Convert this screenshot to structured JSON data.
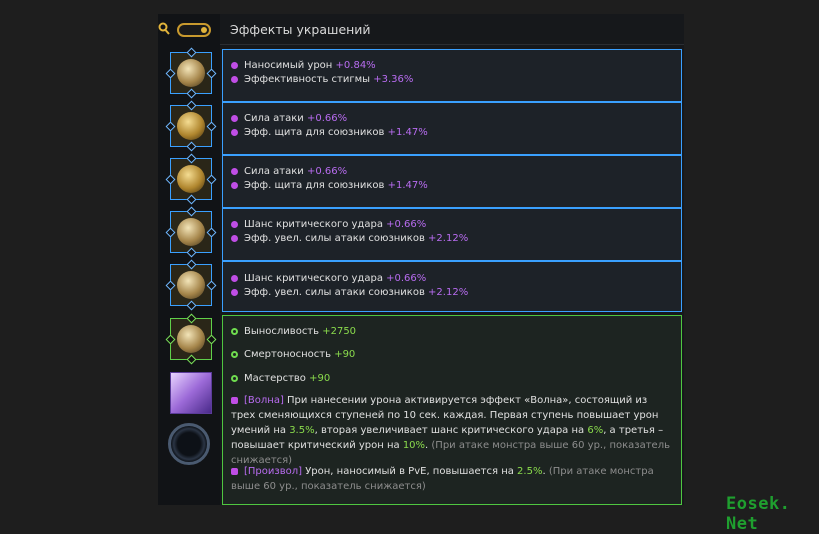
{
  "header": {
    "title": "Эффекты украшений"
  },
  "icons": {
    "search": "search-icon",
    "toggle": "toggle-switch"
  },
  "effects": [
    {
      "lines": [
        {
          "label": "Наносимый урон",
          "value": "+0.84%"
        },
        {
          "label": "Эффективность стигмы",
          "value": "+3.36%"
        }
      ]
    },
    {
      "lines": [
        {
          "label": "Сила атаки",
          "value": "+0.66%"
        },
        {
          "label": "Эфф. щита для союзников",
          "value": "+1.47%"
        }
      ]
    },
    {
      "lines": [
        {
          "label": "Сила атаки",
          "value": "+0.66%"
        },
        {
          "label": "Эфф. щита для союзников",
          "value": "+1.47%"
        }
      ]
    },
    {
      "lines": [
        {
          "label": "Шанс критического удара",
          "value": "+0.66%"
        },
        {
          "label": "Эфф. увел. силы атаки союзников",
          "value": "+2.12%"
        }
      ]
    },
    {
      "lines": [
        {
          "label": "Шанс критического удара",
          "value": "+0.66%"
        },
        {
          "label": "Эфф. увел. силы атаки союзников",
          "value": "+2.12%"
        }
      ]
    }
  ],
  "set_effects": {
    "stats": [
      {
        "label": "Выносливость",
        "value": "+2750"
      },
      {
        "label": "Смертоносность",
        "value": "+90"
      },
      {
        "label": "Мастерство",
        "value": "+90"
      }
    ],
    "wave": {
      "tag": "Волна",
      "text1": " При нанесении урона активируется эффект «Волна», состоящий из трех сменяющихся ступеней по 10 сек. каждая. Первая ступень повышает урон умений на ",
      "v1": "3.5%",
      "text2": ", вторая увеличивает шанс критического удара на ",
      "v2": "6%",
      "text3": ", а третья – повышает критический урон на ",
      "v3": "10%",
      "text4": ". ",
      "note": "(При атаке монстра выше 60 ур., показатель снижается)"
    },
    "arb": {
      "tag": "Произвол",
      "text1": " Урон, наносимый в PvE, повышается на ",
      "v1": "2.5%",
      "text2": ". ",
      "note": "(При атаке монстра выше 60 ур., показатель снижается)"
    }
  },
  "watermark": "Eosek. Net",
  "colors": {
    "blue_border": "#3aa0ff",
    "green_border": "#4fc640",
    "purple_value": "#b86cf0",
    "green_value": "#8adb4c"
  }
}
